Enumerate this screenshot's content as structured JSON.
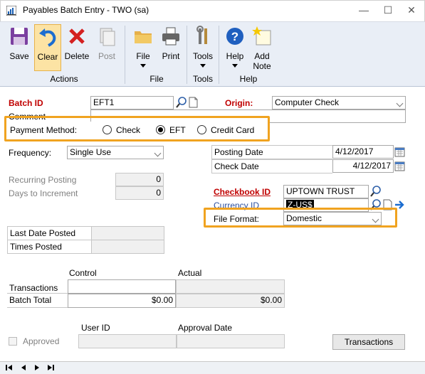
{
  "window": {
    "title": "Payables Batch Entry  -  TWO (sa)"
  },
  "ribbon": {
    "save": "Save",
    "clear": "Clear",
    "delete": "Delete",
    "post": "Post",
    "file": "File",
    "print": "Print",
    "tools": "Tools",
    "help": "Help",
    "add_note_1": "Add",
    "add_note_2": "Note",
    "groups": {
      "actions": "Actions",
      "file": "File",
      "tools": "Tools",
      "help": "Help"
    }
  },
  "form": {
    "batch_id_label": "Batch ID",
    "batch_id_value": "EFT1",
    "origin_label": "Origin:",
    "origin_value": "Computer Check",
    "comment_label": "Comment",
    "payment_method_label": "Payment Method:",
    "pm_check": "Check",
    "pm_eft": "EFT",
    "pm_credit": "Credit Card",
    "frequency_label": "Frequency:",
    "frequency_value": "Single Use",
    "recurring_posting_label": "Recurring Posting",
    "recurring_posting_value": "0",
    "days_to_increment_label": "Days to Increment",
    "days_to_increment_value": "0",
    "posting_date_label": "Posting Date",
    "posting_date_value": "4/12/2017",
    "check_date_label": "Check Date",
    "check_date_value": "4/12/2017",
    "checkbook_id_label": "Checkbook ID",
    "checkbook_id_value": "UPTOWN TRUST",
    "currency_id_label": "Currency ID",
    "currency_id_value": "Z-US$",
    "file_format_label": "File Format:",
    "file_format_value": "Domestic",
    "last_date_posted_label": "Last Date Posted",
    "times_posted_label": "Times Posted",
    "control_header": "Control",
    "actual_header": "Actual",
    "transactions_label": "Transactions",
    "batch_total_label": "Batch Total",
    "batch_total_control": "$0.00",
    "batch_total_actual": "$0.00",
    "user_id_header": "User ID",
    "approval_date_header": "Approval Date",
    "approved_label": "Approved",
    "transactions_button": "Transactions"
  },
  "colors": {
    "highlight": "#f0a320",
    "required_label": "#c00000",
    "ribbon_bg": "#e9eef6"
  }
}
